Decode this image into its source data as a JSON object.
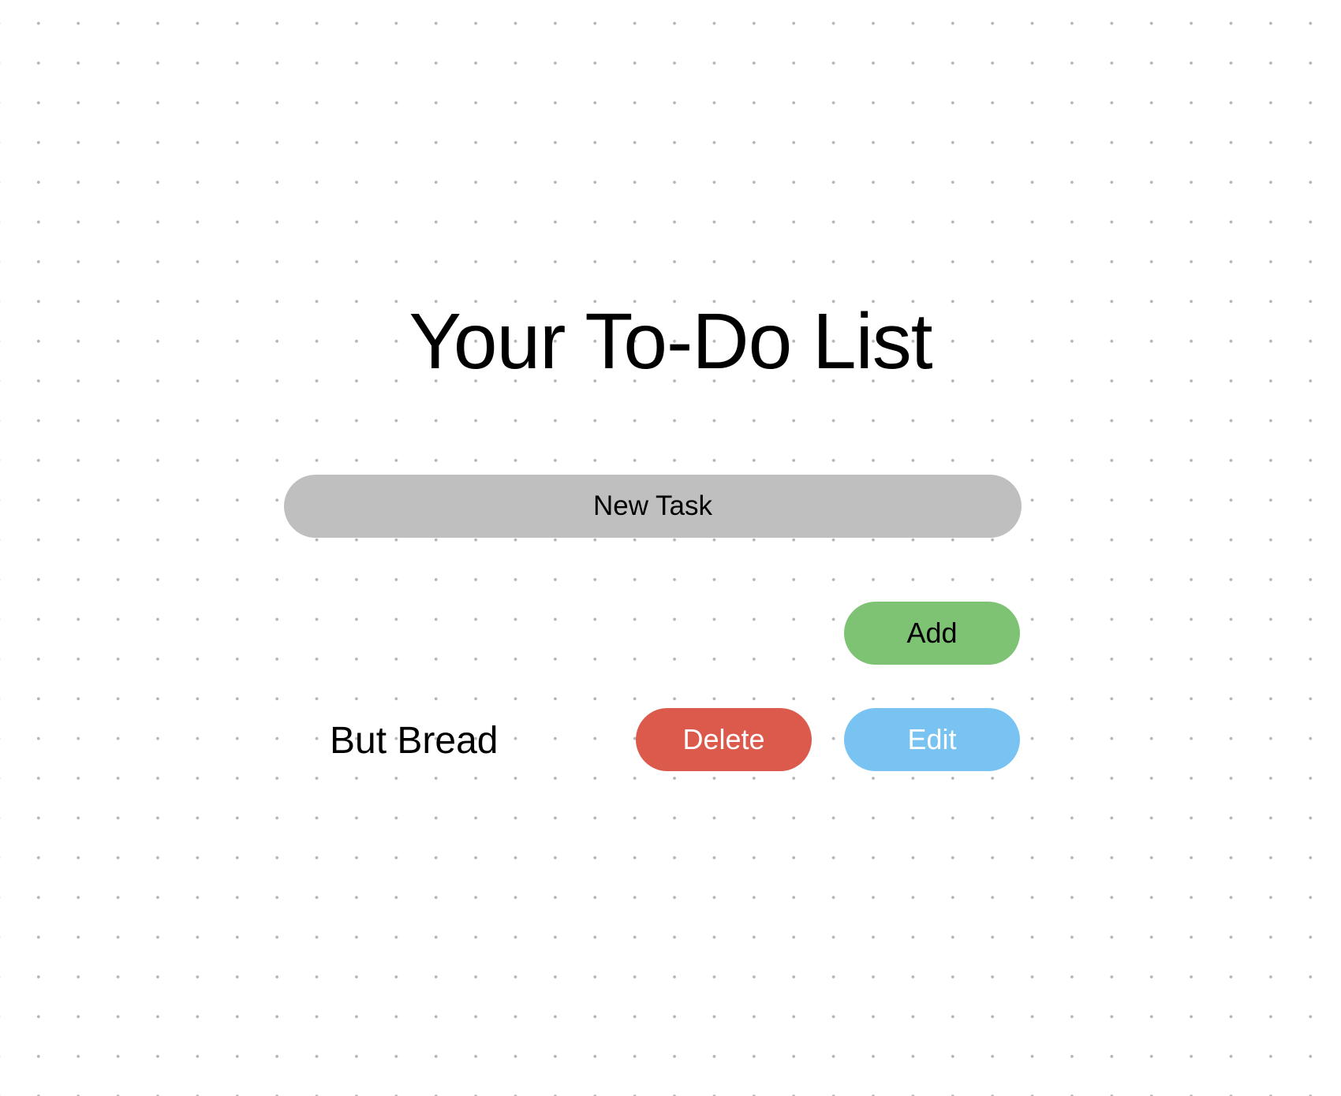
{
  "header": {
    "title": "Your To-Do List"
  },
  "new_task": {
    "placeholder": "New Task",
    "value": ""
  },
  "actions": {
    "add_label": "Add"
  },
  "tasks": [
    {
      "text": "But Bread",
      "delete_label": "Delete",
      "edit_label": "Edit"
    }
  ],
  "colors": {
    "input_background": "#bfbfbf",
    "add_button": "#7ec374",
    "delete_button": "#dc5a4b",
    "edit_button": "#78c3f2",
    "dot_grid": "#b4b4b4"
  }
}
